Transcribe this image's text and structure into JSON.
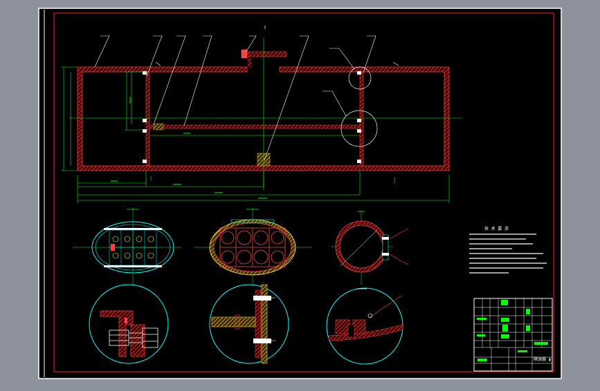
{
  "drawing": {
    "top_mark": "Ⅰ",
    "title_block_caption": "隔油器 ф",
    "notes_heading": "技 术 要 求"
  },
  "colors": {
    "viewport_bg": "#8d929c",
    "sheet_bg": "#000000",
    "frame": "#ffffff",
    "border": "#ff0000",
    "outline": "#ff3b3b",
    "hatch": "#ff2a2a",
    "dimension": "#00ff00",
    "leader": "#ffffff",
    "circle": "#00ffff",
    "bolt": "#ffffff",
    "detail_fill": "#ff4040"
  },
  "icons": {
    "detail_marker": "circle-detail-icon",
    "bolt": "hex-bolt-icon"
  }
}
